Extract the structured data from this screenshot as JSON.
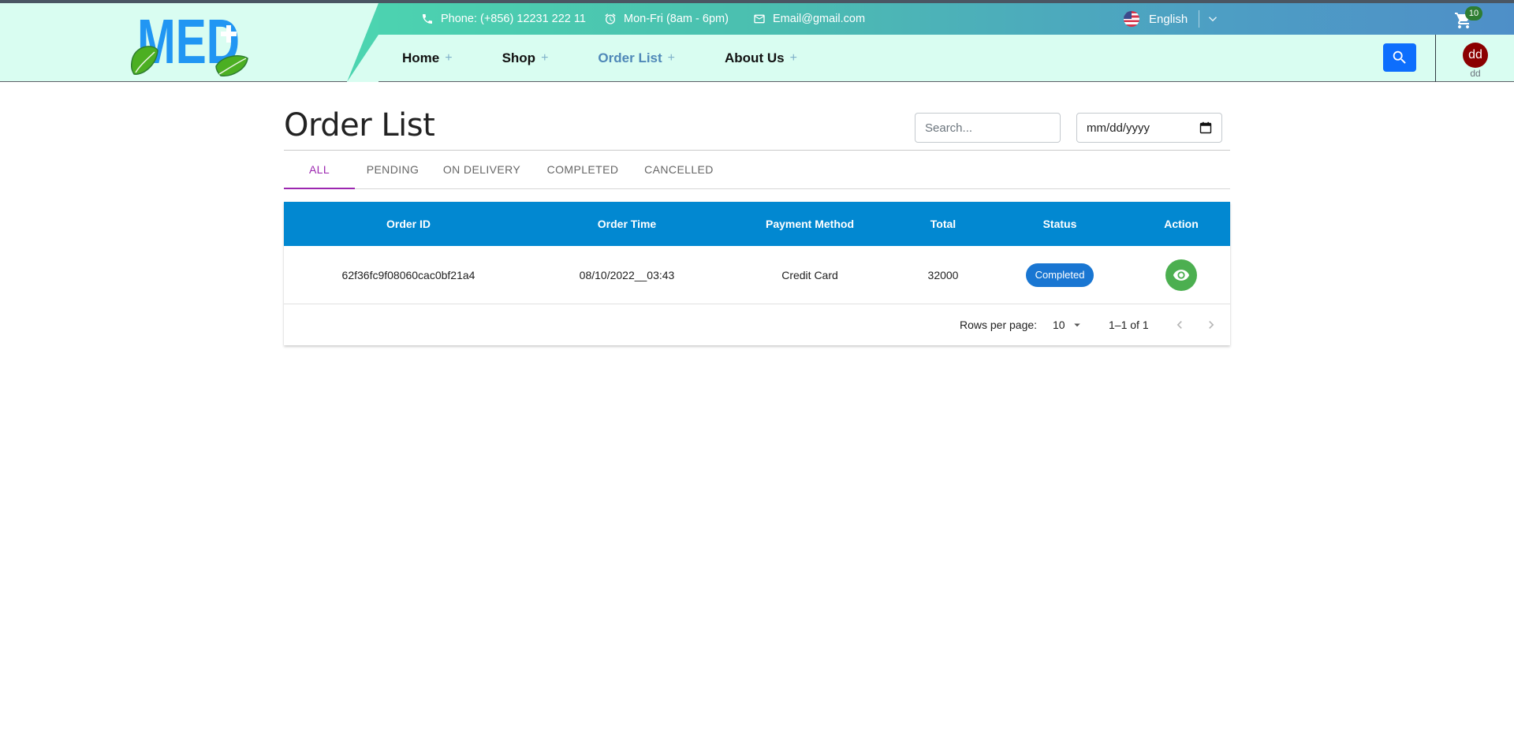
{
  "brand": {
    "logo_text": "MED",
    "primary_color": "#2196f3",
    "leaf_color": "#4caf22"
  },
  "topbar": {
    "phone": "Phone: (+856) 12231 222 11",
    "hours": "Mon-Fri (8am - 6pm)",
    "email": "Email@gmail.com",
    "language": "English",
    "cart_count": "10"
  },
  "nav": {
    "items": [
      {
        "label": "Home",
        "plus": "+"
      },
      {
        "label": "Shop",
        "plus": "+"
      },
      {
        "label": "Order List",
        "plus": "+"
      },
      {
        "label": "About Us",
        "plus": "+"
      }
    ],
    "active": "Order List"
  },
  "user": {
    "avatar_initials": "dd",
    "name": "dd"
  },
  "page": {
    "title": "Order List",
    "search_placeholder": "Search...",
    "date_placeholder": "mm/dd/yyyy"
  },
  "tabs": [
    {
      "label": "ALL"
    },
    {
      "label": "PENDING"
    },
    {
      "label": "ON DELIVERY"
    },
    {
      "label": "COMPLETED"
    },
    {
      "label": "CANCELLED"
    }
  ],
  "table": {
    "columns": [
      "Order ID",
      "Order Time",
      "Payment Method",
      "Total",
      "Status",
      "Action"
    ],
    "rows": [
      {
        "order_id": "62f36fc9f08060cac0bf21a4",
        "order_time": "08/10/2022__03:43",
        "payment_method": "Credit Card",
        "total": "32000",
        "status": "Completed"
      }
    ]
  },
  "pagination": {
    "rows_per_page_label": "Rows per page:",
    "rows_per_page": "10",
    "range": "1–1 of 1"
  },
  "colors": {
    "header_bg": "#d9fdf1",
    "table_header": "#0288d1",
    "active_tab": "#9c27b0",
    "status_chip": "#1976d2",
    "view_button": "#4caf50",
    "search_button": "#0d6efd",
    "avatar": "#8b0000"
  }
}
